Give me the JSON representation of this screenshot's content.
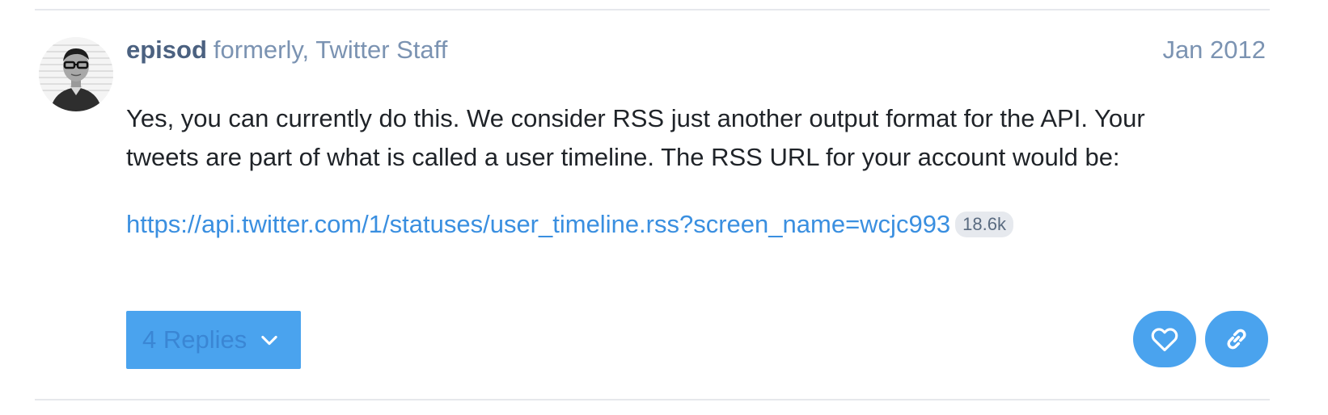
{
  "post": {
    "username": "episod",
    "user_title": "formerly, Twitter Staff",
    "date": "Jan 2012",
    "body": "Yes, you can currently do this. We consider RSS just another output format for the API. Your tweets are part of what is called a user timeline. The RSS URL for your account would be:",
    "link_text": "https://api.twitter.com/1/statuses/user_timeline.rss?screen_name=wcjc993",
    "link_clicks": "18.6k"
  },
  "actions": {
    "replies_label": "4 Replies",
    "replies_icon": "chevron-down-icon",
    "like_icon": "heart-icon",
    "share_icon": "link-icon"
  },
  "colors": {
    "accent": "#4aa3ee",
    "link": "#3a8fe0",
    "username": "#4b6180",
    "muted": "#7b93b2",
    "text": "#1f2328"
  }
}
